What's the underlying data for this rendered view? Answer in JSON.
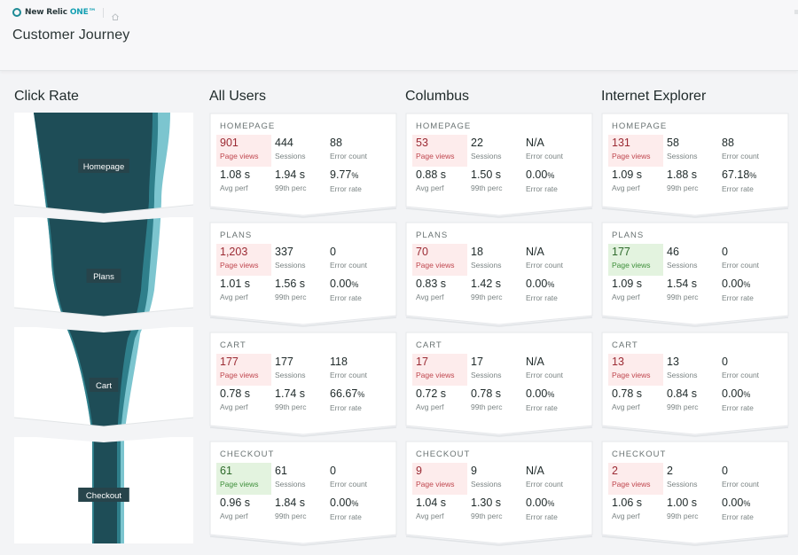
{
  "header": {
    "brand_name": "New Relic",
    "brand_suffix": "ONE™",
    "page_title": "Customer Journey"
  },
  "funnel": {
    "title": "Click Rate",
    "colors": {
      "main": "#1e4d57",
      "mid": "#2f7f8b",
      "light": "#7cc5cf",
      "label_bg": "#27444b"
    },
    "stages": [
      {
        "label": "Homepage"
      },
      {
        "label": "Plans"
      },
      {
        "label": "Cart"
      },
      {
        "label": "Checkout"
      }
    ]
  },
  "metric_labels": {
    "page_views": "Page views",
    "sessions": "Sessions",
    "error_count": "Error count",
    "avg_perf": "Avg perf",
    "p99": "99th perc",
    "error_rate": "Error rate"
  },
  "colors": {
    "highlight_bad_bg": "#fdecec",
    "highlight_good_bg": "#e3f3df"
  },
  "columns": [
    {
      "title": "All Users",
      "cards": [
        {
          "stage": "HOMEPAGE",
          "page_views": "901",
          "page_views_status": "bad",
          "sessions": "444",
          "error_count": "88",
          "avg_perf": "1.08 s",
          "p99": "1.94 s",
          "error_rate": "9.77",
          "pct": "%"
        },
        {
          "stage": "PLANS",
          "page_views": "1,203",
          "page_views_status": "bad",
          "sessions": "337",
          "error_count": "0",
          "avg_perf": "1.01 s",
          "p99": "1.56 s",
          "error_rate": "0.00",
          "pct": "%"
        },
        {
          "stage": "CART",
          "page_views": "177",
          "page_views_status": "bad",
          "sessions": "177",
          "error_count": "118",
          "avg_perf": "0.78 s",
          "p99": "1.74 s",
          "error_rate": "66.67",
          "pct": "%"
        },
        {
          "stage": "CHECKOUT",
          "page_views": "61",
          "page_views_status": "good",
          "sessions": "61",
          "error_count": "0",
          "avg_perf": "0.96 s",
          "p99": "1.84 s",
          "error_rate": "0.00",
          "pct": "%"
        }
      ]
    },
    {
      "title": "Columbus",
      "cards": [
        {
          "stage": "HOMEPAGE",
          "page_views": "53",
          "page_views_status": "bad",
          "sessions": "22",
          "error_count": "N/A",
          "avg_perf": "0.88 s",
          "p99": "1.50 s",
          "error_rate": "0.00",
          "pct": "%"
        },
        {
          "stage": "PLANS",
          "page_views": "70",
          "page_views_status": "bad",
          "sessions": "18",
          "error_count": "N/A",
          "avg_perf": "0.83 s",
          "p99": "1.42 s",
          "error_rate": "0.00",
          "pct": "%"
        },
        {
          "stage": "CART",
          "page_views": "17",
          "page_views_status": "bad",
          "sessions": "17",
          "error_count": "N/A",
          "avg_perf": "0.72 s",
          "p99": "0.78 s",
          "error_rate": "0.00",
          "pct": "%"
        },
        {
          "stage": "CHECKOUT",
          "page_views": "9",
          "page_views_status": "bad",
          "sessions": "9",
          "error_count": "N/A",
          "avg_perf": "1.04 s",
          "p99": "1.30 s",
          "error_rate": "0.00",
          "pct": "%"
        }
      ]
    },
    {
      "title": "Internet Explorer",
      "cards": [
        {
          "stage": "HOMEPAGE",
          "page_views": "131",
          "page_views_status": "bad",
          "sessions": "58",
          "error_count": "88",
          "avg_perf": "1.09 s",
          "p99": "1.88 s",
          "error_rate": "67.18",
          "pct": "%"
        },
        {
          "stage": "PLANS",
          "page_views": "177",
          "page_views_status": "good",
          "sessions": "46",
          "error_count": "0",
          "avg_perf": "1.09 s",
          "p99": "1.54 s",
          "error_rate": "0.00",
          "pct": "%"
        },
        {
          "stage": "CART",
          "page_views": "13",
          "page_views_status": "bad",
          "sessions": "13",
          "error_count": "0",
          "avg_perf": "0.78 s",
          "p99": "0.84 s",
          "error_rate": "0.00",
          "pct": "%"
        },
        {
          "stage": "CHECKOUT",
          "page_views": "2",
          "page_views_status": "bad",
          "sessions": "2",
          "error_count": "0",
          "avg_perf": "1.06 s",
          "p99": "1.00 s",
          "error_rate": "0.00",
          "pct": "%"
        }
      ]
    }
  ]
}
